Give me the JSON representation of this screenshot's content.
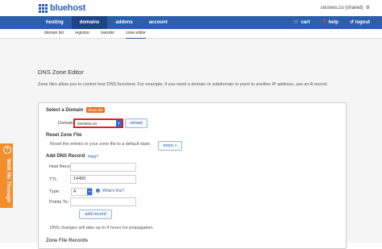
{
  "header": {
    "logo_text": "bluehost",
    "account_text": "sixsixes.co (shared)",
    "account_icon": "user-gear-icon"
  },
  "nav": {
    "items": [
      "hosting",
      "domains",
      "addons",
      "account"
    ],
    "active": "domains",
    "right_items": [
      "cart",
      "help",
      "logout"
    ]
  },
  "subnav": {
    "items": [
      "domain list",
      "registrar",
      "transfer",
      "zone editor"
    ],
    "active": "zone editor"
  },
  "page": {
    "title": "DNS Zone Editor",
    "intro": "Zone files allow you to control how DNS functions. For example, if you need a domain or subdomain to point to another IP address, use an A record."
  },
  "select_domain": {
    "heading": "Select a Domain",
    "badge": "Show Me",
    "domain_label": "Domain:",
    "domain_value": "sixsixes.co",
    "reload_label": "reload"
  },
  "reset_zone": {
    "heading": "Reset Zone File",
    "description": "Reset the entries in your zone file to a default state.",
    "more_label": "more »"
  },
  "add_record": {
    "heading": "Add DNS Record",
    "help_label": "Help?",
    "host_label": "Host Record:",
    "host_value": "",
    "ttl_label": "TTL:",
    "ttl_value": "14400",
    "type_label": "Type:",
    "type_value": "A",
    "whats_this": "What's this?",
    "points_label": "Points To:",
    "points_value": "",
    "add_label": "add record",
    "propagation_note": "DNS changes will take up to 4 hours for propagation."
  },
  "zone_records": {
    "heading": "Zone File Records"
  },
  "side_tab": {
    "label": "Walk Me Through"
  },
  "colors": {
    "brand_blue": "#2c5fa8",
    "active_nav": "#1c4683",
    "badge_orange": "#e8722a",
    "side_tab_orange": "#f28e2b",
    "highlight_red": "#e02020"
  }
}
